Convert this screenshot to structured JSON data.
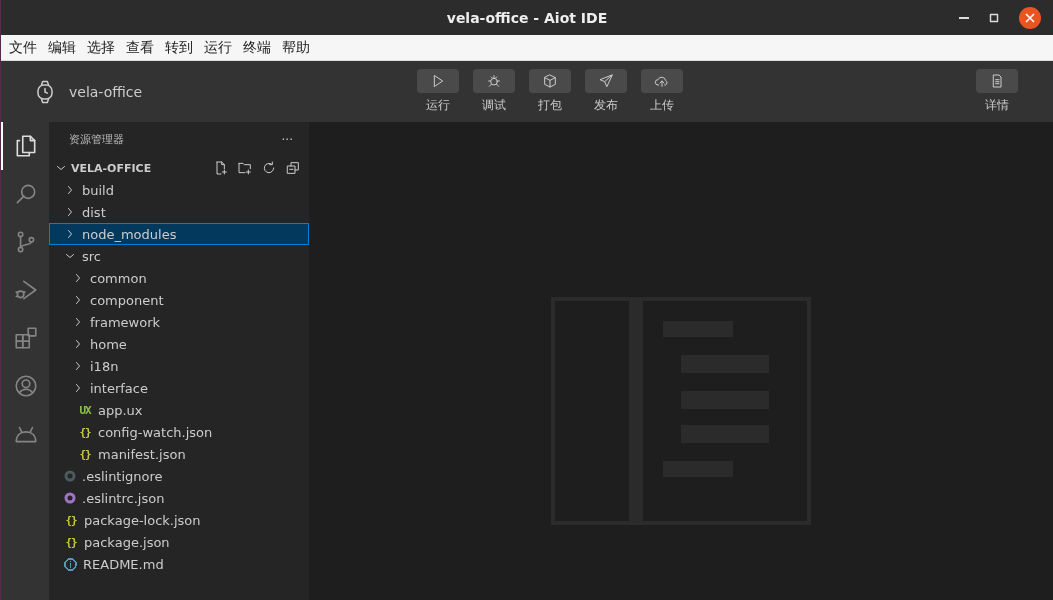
{
  "window": {
    "title": "vela-office - Aiot IDE"
  },
  "menu": [
    "文件",
    "编辑",
    "选择",
    "查看",
    "转到",
    "运行",
    "终端",
    "帮助"
  ],
  "project": {
    "name": "vela-office"
  },
  "toolbar": [
    {
      "kind": "run",
      "label": "运行"
    },
    {
      "kind": "debug",
      "label": "调试"
    },
    {
      "kind": "pack",
      "label": "打包"
    },
    {
      "kind": "publish",
      "label": "发布"
    },
    {
      "kind": "upload",
      "label": "上传"
    }
  ],
  "details": {
    "label": "详情"
  },
  "activity": [
    {
      "kind": "explorer",
      "selected": true
    },
    {
      "kind": "search",
      "selected": false
    },
    {
      "kind": "scm",
      "selected": false
    },
    {
      "kind": "debug",
      "selected": false
    },
    {
      "kind": "extensions",
      "selected": false
    },
    {
      "kind": "account",
      "selected": false
    },
    {
      "kind": "android",
      "selected": false
    }
  ],
  "explorer": {
    "title": "资源管理器",
    "more": "···",
    "root": {
      "label": "VELA-OFFICE",
      "expanded": true
    },
    "tree": [
      {
        "kind": "folder",
        "label": "build",
        "expanded": false,
        "selected": false
      },
      {
        "kind": "folder",
        "label": "dist",
        "expanded": false,
        "selected": false
      },
      {
        "kind": "folder",
        "label": "node_modules",
        "expanded": false,
        "selected": true
      },
      {
        "kind": "folder",
        "label": "src",
        "expanded": true,
        "selected": false,
        "children": [
          {
            "kind": "folder",
            "label": "common",
            "expanded": false,
            "selected": false
          },
          {
            "kind": "folder",
            "label": "component",
            "expanded": false,
            "selected": false
          },
          {
            "kind": "folder",
            "label": "framework",
            "expanded": false,
            "selected": false
          },
          {
            "kind": "folder",
            "label": "home",
            "expanded": false,
            "selected": false
          },
          {
            "kind": "folder",
            "label": "i18n",
            "expanded": false,
            "selected": false
          },
          {
            "kind": "folder",
            "label": "interface",
            "expanded": false,
            "selected": false
          },
          {
            "kind": "file",
            "label": "app.ux",
            "glyph": "UX",
            "color": "#8dc149",
            "selected": false
          },
          {
            "kind": "file",
            "label": "config-watch.json",
            "glyph": "{}",
            "color": "#cbcb41",
            "selected": false
          },
          {
            "kind": "file",
            "label": "manifest.json",
            "glyph": "{}",
            "color": "#cbcb41",
            "selected": false
          }
        ]
      },
      {
        "kind": "ring",
        "label": ".eslintignore",
        "color": "#4d5a5e",
        "selected": false
      },
      {
        "kind": "ring",
        "label": ".eslintrc.json",
        "color": "#a074c4",
        "selected": false
      },
      {
        "kind": "file",
        "label": "package-lock.json",
        "glyph": "{}",
        "color": "#cbcb41",
        "selected": false
      },
      {
        "kind": "file",
        "label": "package.json",
        "glyph": "{}",
        "color": "#cbcb41",
        "selected": false
      },
      {
        "kind": "info",
        "label": "README.md",
        "color": "#519aba",
        "selected": false
      }
    ]
  }
}
